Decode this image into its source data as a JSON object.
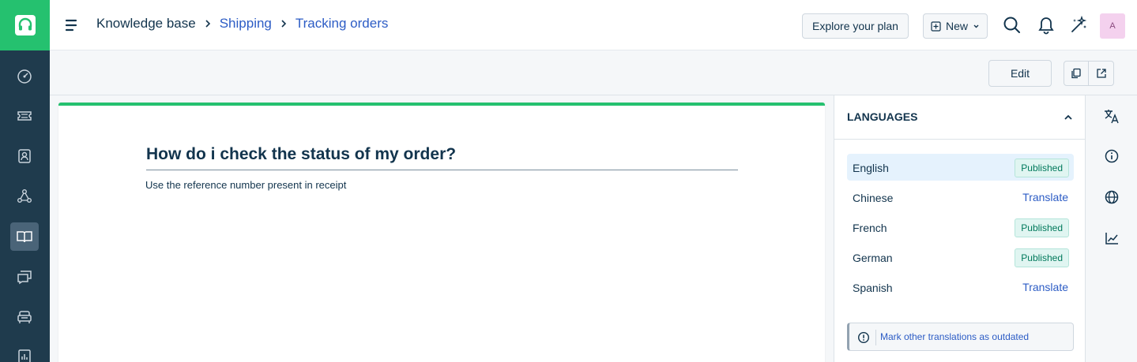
{
  "app": {
    "brand_color": "#25c16f",
    "nav_bg": "#1f3b4d"
  },
  "leftnav": {
    "items": [
      {
        "name": "dashboard",
        "icon": "dashboard-gauge-icon"
      },
      {
        "name": "tickets",
        "icon": "ticket-icon"
      },
      {
        "name": "contacts",
        "icon": "contact-card-icon"
      },
      {
        "name": "groups",
        "icon": "network-icon"
      },
      {
        "name": "solutions",
        "icon": "book-icon",
        "active": true
      },
      {
        "name": "forums",
        "icon": "chat-bubbles-icon"
      },
      {
        "name": "assets",
        "icon": "assets-icon"
      },
      {
        "name": "reports",
        "icon": "report-chart-icon"
      }
    ]
  },
  "header": {
    "breadcrumb": {
      "root": "Knowledge base",
      "level1": "Shipping",
      "level2": "Tracking orders"
    },
    "explore_label": "Explore your plan",
    "new_label": "New",
    "avatar_initial": "A"
  },
  "toolbar": {
    "edit_label": "Edit"
  },
  "article": {
    "title": "How do i check the status of my order?",
    "body": "Use the reference number present in receipt"
  },
  "languages": {
    "title": "LANGUAGES",
    "items": [
      {
        "name": "English",
        "status": "Published",
        "selected": true
      },
      {
        "name": "Chinese",
        "action": "Translate"
      },
      {
        "name": "French",
        "status": "Published"
      },
      {
        "name": "German",
        "status": "Published"
      },
      {
        "name": "Spanish",
        "action": "Translate"
      }
    ],
    "outdated_link": "Mark other translations as outdated"
  },
  "rail": {
    "icons": [
      "translate-icon",
      "info-icon",
      "globe-icon",
      "analytics-icon"
    ]
  }
}
